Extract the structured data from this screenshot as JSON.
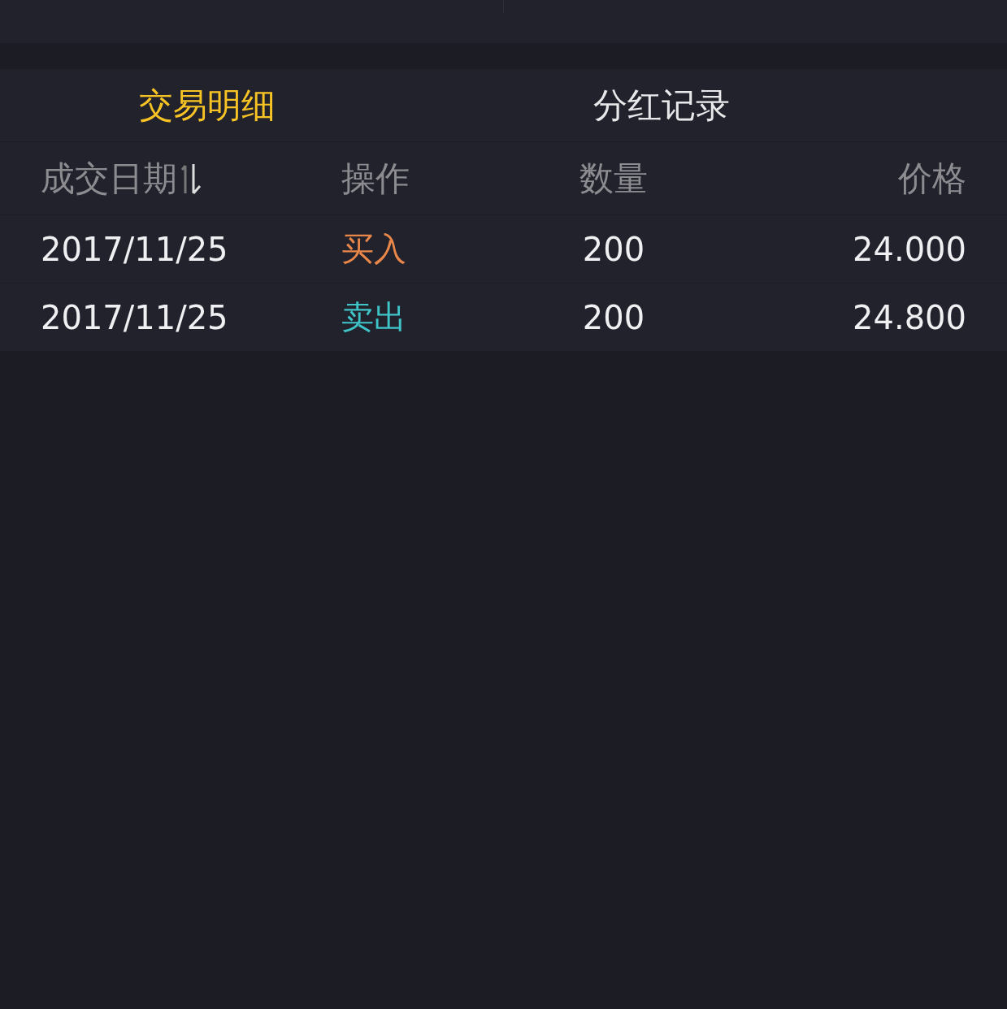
{
  "tabs": [
    {
      "label": "交易明细",
      "selected": true
    },
    {
      "label": "分红记录",
      "selected": false
    }
  ],
  "table": {
    "columns": [
      "成交日期",
      "操作",
      "数量",
      "价格"
    ],
    "rows": [
      {
        "date": "2017/11/25",
        "action": "买入",
        "kind": "buy",
        "quantity": "200",
        "price": "24.000"
      },
      {
        "date": "2017/11/25",
        "action": "卖出",
        "kind": "sell",
        "quantity": "200",
        "price": "24.800"
      }
    ]
  }
}
